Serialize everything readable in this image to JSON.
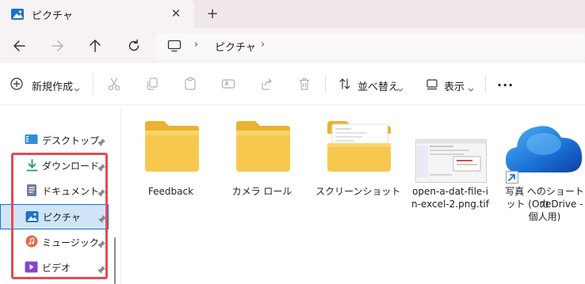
{
  "tab": {
    "title": "ピクチャ",
    "close": "✕",
    "add": "+"
  },
  "nav": {
    "back": "back",
    "forward": "forward",
    "up": "up",
    "refresh": "refresh"
  },
  "address": {
    "crumbs": [
      "ピクチャ"
    ],
    "separator": "›"
  },
  "toolbar": {
    "new_label": "新規作成",
    "sort_label": "並べ替え",
    "view_label": "表示",
    "more_label": "..."
  },
  "sidebar": {
    "items": [
      {
        "label": "デスクトップ",
        "icon": "desktop-icon"
      },
      {
        "label": "ダウンロード",
        "icon": "download-icon"
      },
      {
        "label": "ドキュメント",
        "icon": "document-icon"
      },
      {
        "label": "ピクチャ",
        "icon": "picture-icon",
        "selected": true
      },
      {
        "label": "ミュージック",
        "icon": "music-icon"
      },
      {
        "label": "ビデオ",
        "icon": "video-icon"
      }
    ]
  },
  "content": {
    "items": [
      {
        "label": "Feedback",
        "type": "folder"
      },
      {
        "label": "カメラ ロール",
        "type": "folder"
      },
      {
        "label": "スクリーンショット",
        "type": "folder-with-preview"
      },
      {
        "label_line1": "open-a-dat-file-i",
        "label_line2": "n-excel-2.png.tif",
        "type": "image-file"
      },
      {
        "label_line1": "写真 へのショートカ",
        "label_line2": "ット (OneDrive -",
        "label_line3": "個人用)",
        "type": "shortcut"
      }
    ]
  },
  "colors": {
    "accent": "#1a73c7",
    "highlight": "#e54a53",
    "folder": "#f6c94e"
  }
}
